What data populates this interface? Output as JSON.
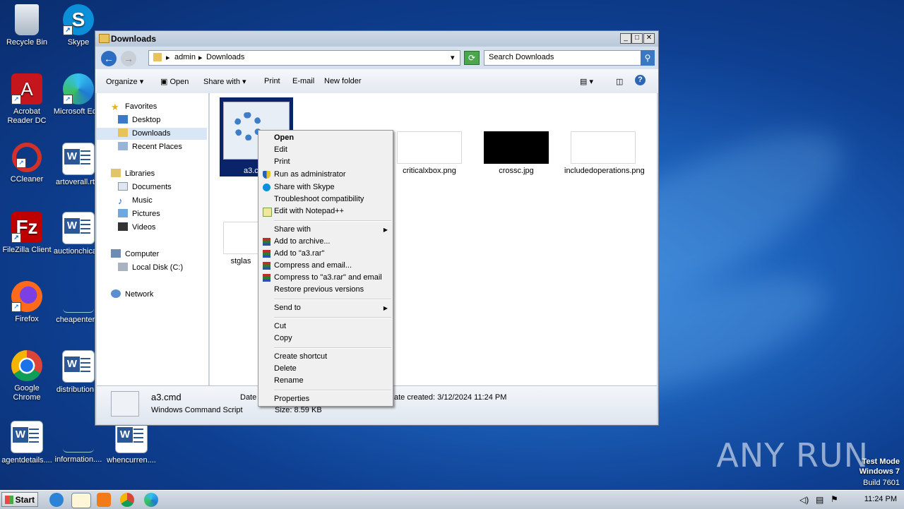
{
  "desktop": {
    "icons": [
      {
        "label": "Recycle Bin"
      },
      {
        "label": "Skype"
      },
      {
        "label": "Acrobat Reader DC"
      },
      {
        "label": "Microsoft Ed..."
      },
      {
        "label": "CCleaner"
      },
      {
        "label": "artoverall.rt..."
      },
      {
        "label": "FileZilla Client"
      },
      {
        "label": "auctionchica..."
      },
      {
        "label": "Firefox"
      },
      {
        "label": "cheapenter..."
      },
      {
        "label": "Google Chrome"
      },
      {
        "label": "distribution..."
      },
      {
        "label": "agentdetails...."
      },
      {
        "label": "information...."
      },
      {
        "label": "whencurren...."
      }
    ],
    "watermark": "ANY RUN",
    "test_mode": "Test Mode",
    "os_name": "Windows 7",
    "build": "Build 7601"
  },
  "window": {
    "title": "Downloads",
    "breadcrumb": [
      "admin",
      "Downloads"
    ],
    "search_placeholder": "Search Downloads",
    "toolbar": {
      "organize": "Organize",
      "open": "Open",
      "share_with": "Share with",
      "print": "Print",
      "email": "E-mail",
      "new_folder": "New folder"
    },
    "nav": {
      "favorites": "Favorites",
      "desktop": "Desktop",
      "downloads": "Downloads",
      "recent_places": "Recent Places",
      "libraries": "Libraries",
      "documents": "Documents",
      "music": "Music",
      "pictures": "Pictures",
      "videos": "Videos",
      "computer": "Computer",
      "local_disk": "Local Disk (C:)",
      "network": "Network"
    },
    "files": [
      {
        "name": "a3.cmd",
        "short": "a3.c"
      },
      {
        "name": "criticalxbox.png"
      },
      {
        "name": "crossc.jpg"
      },
      {
        "name": "includedoperations.png"
      },
      {
        "name": "stglass",
        "short": "stglas"
      }
    ],
    "details": {
      "name": "a3.cmd",
      "type": "Windows Command Script",
      "date_modified_label": "Date",
      "date_created": "ate created: 3/12/2024 11:24 PM",
      "size": "Size: 8.59 KB"
    }
  },
  "context_menu": {
    "items": [
      {
        "label": "Open"
      },
      {
        "label": "Edit"
      },
      {
        "label": "Print"
      },
      {
        "label": "Run as administrator"
      },
      {
        "label": "Share with Skype"
      },
      {
        "label": "Troubleshoot compatibility"
      },
      {
        "label": "Edit with Notepad++"
      },
      {
        "label": "Share with"
      },
      {
        "label": "Add to archive..."
      },
      {
        "label": "Add to \"a3.rar\""
      },
      {
        "label": "Compress and email..."
      },
      {
        "label": "Compress to \"a3.rar\" and email"
      },
      {
        "label": "Restore previous versions"
      },
      {
        "label": "Send to"
      },
      {
        "label": "Cut"
      },
      {
        "label": "Copy"
      },
      {
        "label": "Create shortcut"
      },
      {
        "label": "Delete"
      },
      {
        "label": "Rename"
      },
      {
        "label": "Properties"
      }
    ]
  },
  "taskbar": {
    "start": "Start",
    "clock": "11:24 PM"
  }
}
